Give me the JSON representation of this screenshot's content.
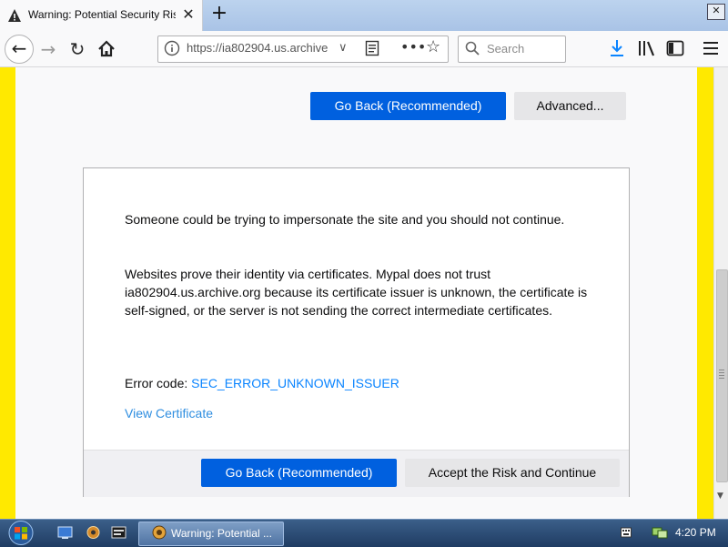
{
  "browser": {
    "tab": {
      "title": "Warning: Potential Security Risk Ahead",
      "close_glyph": "✕"
    },
    "new_tab_glyph": "+",
    "window_button_glyph": "✕",
    "nav": {
      "back_glyph": "←",
      "forward_glyph": "→",
      "reload_glyph": "↻"
    },
    "url": "https://ia802904.us.archive",
    "url_dropdown_glyph": "∨",
    "page_actions_glyph": "•••",
    "bookmark_glyph": "☆",
    "search_placeholder": "Search"
  },
  "page": {
    "top_buttons": {
      "go_back": "Go Back (Recommended)",
      "advanced": "Advanced..."
    },
    "message_1": "Someone could be trying to impersonate the site and you should not continue.",
    "message_2": "Websites prove their identity via certificates. Mypal does not trust ia802904.us.archive.org because its certificate issuer is unknown, the certificate is self-signed, or the server is not sending the correct intermediate certificates.",
    "error_code_label": "Error code: ",
    "error_code": "SEC_ERROR_UNKNOWN_ISSUER",
    "view_certificate": "View Certificate",
    "bottom_buttons": {
      "go_back": "Go Back (Recommended)",
      "accept": "Accept the Risk and Continue"
    }
  },
  "taskbar": {
    "app_label": "Warning: Potential ...",
    "clock": "4:20 PM"
  },
  "colors": {
    "accent_blue": "#0060df",
    "warning_border": "#ffe900",
    "link": "#0a84ff"
  },
  "icons": [
    "warning-icon",
    "back-icon",
    "forward-icon",
    "reload-icon",
    "home-icon",
    "lock-icon",
    "reader-icon",
    "star-icon",
    "search-icon",
    "download-icon",
    "library-icon",
    "sidebar-icon",
    "menu-icon",
    "start-icon"
  ]
}
